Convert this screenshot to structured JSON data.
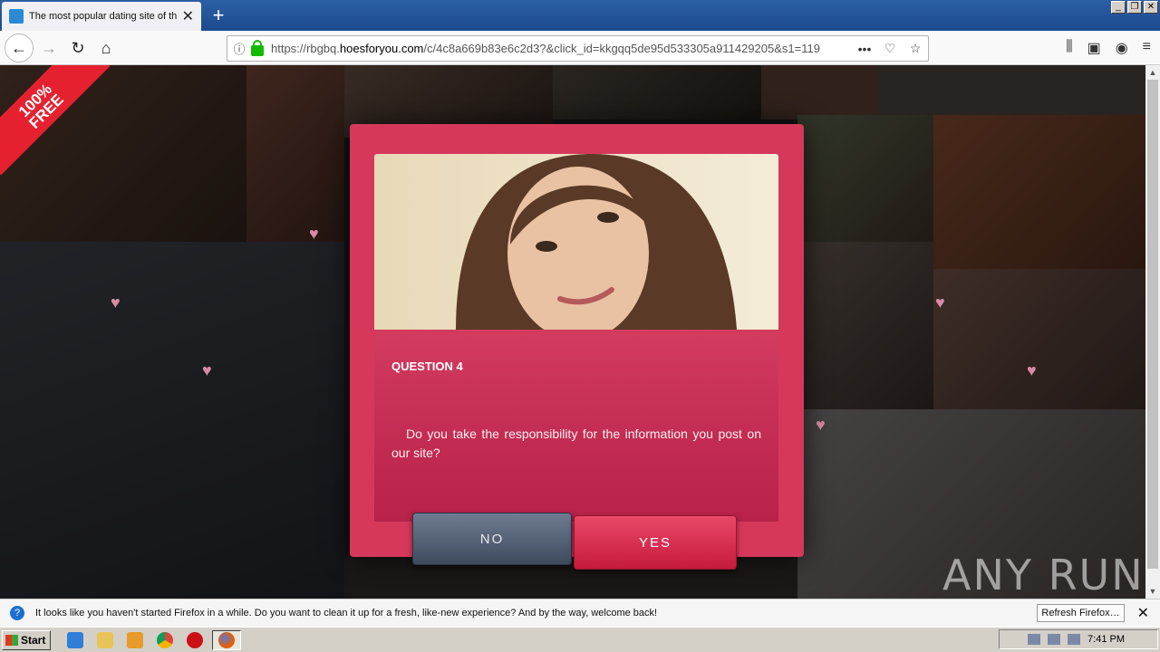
{
  "browser": {
    "tab_title": "The most popular dating site of th",
    "tab_close": "✕",
    "new_tab": "+",
    "url_prefix": "https://rbgbq.",
    "url_domain": "hoesforyou.com",
    "url_rest": "/c/4c8a669b83e6c2d3?&click_id=kkgqq5de95d533305a911429205&s1=119",
    "window_buttons": [
      "_",
      "❐",
      "✕"
    ]
  },
  "page": {
    "ribbon": "100%\nFREE",
    "modal": {
      "question_label": "QUESTION 4",
      "question_text": "Do you take the responsibility for the information you post on our site?",
      "no_label": "NO",
      "yes_label": "YES"
    },
    "watermark": "ANY RUN"
  },
  "notification": {
    "message": "It looks like you haven't started Firefox in a while. Do you want to clean it up for a fresh, like-new experience? And by the way, welcome back!",
    "button": "Refresh Firefox…"
  },
  "taskbar": {
    "start_label": "Start",
    "clock": "7:41 PM"
  },
  "colors": {
    "modal_bg": "#d6385c",
    "yes": "#d8264a",
    "no": "#56627a",
    "ribbon": "#e52130"
  }
}
